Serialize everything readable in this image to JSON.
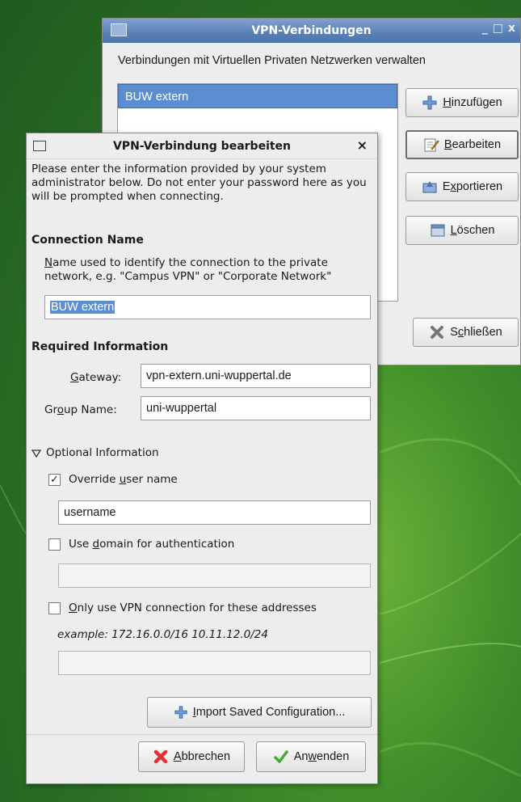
{
  "back_window": {
    "title": "VPN-Verbindungen",
    "description": "Verbindungen mit Virtuellen Privaten Netzwerken verwalten",
    "connections": [
      "BUW extern"
    ],
    "buttons": {
      "add": {
        "pre": "",
        "u": "H",
        "post": "inzufügen"
      },
      "edit": {
        "pre": "",
        "u": "B",
        "post": "earbeiten"
      },
      "export": {
        "pre": "E",
        "u": "x",
        "post": "portieren"
      },
      "delete": {
        "pre": "",
        "u": "L",
        "post": "öschen"
      },
      "close": {
        "pre": "S",
        "u": "c",
        "post": "hließen"
      }
    },
    "controls": {
      "minimize": "_",
      "maximize": "□",
      "close": "x"
    }
  },
  "dialog": {
    "title": "VPN-Verbindung bearbeiten",
    "close_glyph": "×",
    "info_text": "Please enter the information provided by your system administrator below. Do not enter your password here as you will be prompted when connecting.",
    "connection_name": {
      "heading": "Connection Name",
      "hint_u": "N",
      "hint_rest": "ame used to identify the connection to the private network, e.g. \"Campus VPN\" or \"Corporate Network\"",
      "value": "BUW extern"
    },
    "required": {
      "heading": "Required Information",
      "gateway_u": "G",
      "gateway_rest": "ateway:",
      "gateway_value": "vpn-extern.uni-wuppertal.de",
      "group_pre": "Gr",
      "group_u": "o",
      "group_post": "up Name:",
      "group_value": "uni-wuppertal"
    },
    "optional": {
      "heading": "Optional Information",
      "override_pre": "Override ",
      "override_u": "u",
      "override_post": "ser name",
      "override_checked": true,
      "username_value": "username",
      "domain_pre": "Use ",
      "domain_u": "d",
      "domain_post": "omain for authentication",
      "domain_checked": false,
      "only_u": "O",
      "only_post": "nly use VPN connection for these addresses",
      "only_checked": false,
      "example": "example: 172.16.0.0/16 10.11.12.0/24"
    },
    "import_button": {
      "pre": "",
      "u": "I",
      "post": "mport Saved Configuration..."
    },
    "cancel_button": {
      "pre": "",
      "u": "A",
      "post": "bbrechen"
    },
    "apply_button": {
      "pre": "An",
      "u": "w",
      "post": "enden"
    }
  }
}
